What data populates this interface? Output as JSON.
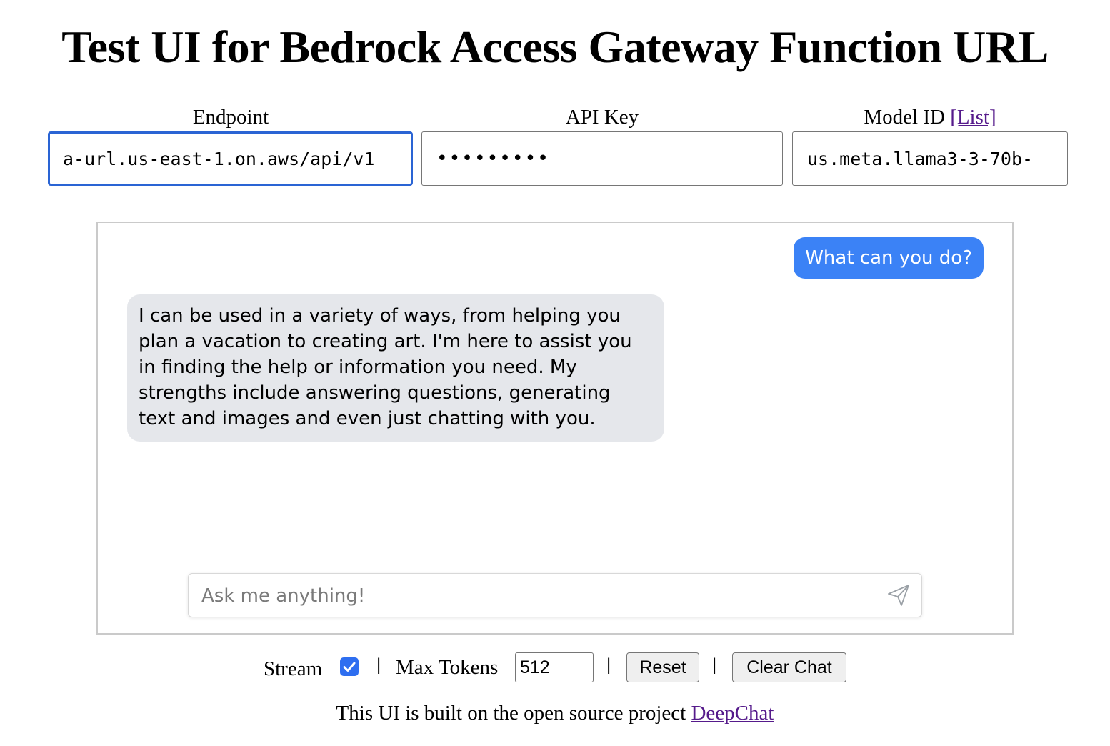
{
  "page": {
    "title": "Test UI for Bedrock Access Gateway Function URL"
  },
  "settings": {
    "endpoint": {
      "label": "Endpoint",
      "value": "a-url.us-east-1.on.aws/api/v1"
    },
    "api_key": {
      "label": "API Key",
      "value": "•••••••••"
    },
    "model_id": {
      "label": "Model ID",
      "list_link": "[List]",
      "value": "us.meta.llama3-3-70b-"
    }
  },
  "chat": {
    "messages": [
      {
        "role": "user",
        "text": "What can you do?"
      },
      {
        "role": "ai",
        "text": "I can be used in a variety of ways, from helping you plan a vacation to creating art. I'm here to assist you in finding the help or information you need. My strengths include answering questions, generating text and images and even just chatting with you."
      }
    ],
    "input_placeholder": "Ask me anything!",
    "send_icon": "paper-plane-icon"
  },
  "controls": {
    "stream_label": "Stream",
    "stream_checked": true,
    "separator": "|",
    "max_tokens_label": "Max Tokens",
    "max_tokens_value": "512",
    "reset_label": "Reset",
    "clear_chat_label": "Clear Chat"
  },
  "footer": {
    "text": "This UI is built on the open source project",
    "link_text": "DeepChat"
  },
  "colors": {
    "user_bubble": "#3b82f6",
    "ai_bubble": "#e5e7eb",
    "focus_border": "#2a64d4",
    "checkbox": "#2e6ef0",
    "visited_link": "#551a8b"
  }
}
